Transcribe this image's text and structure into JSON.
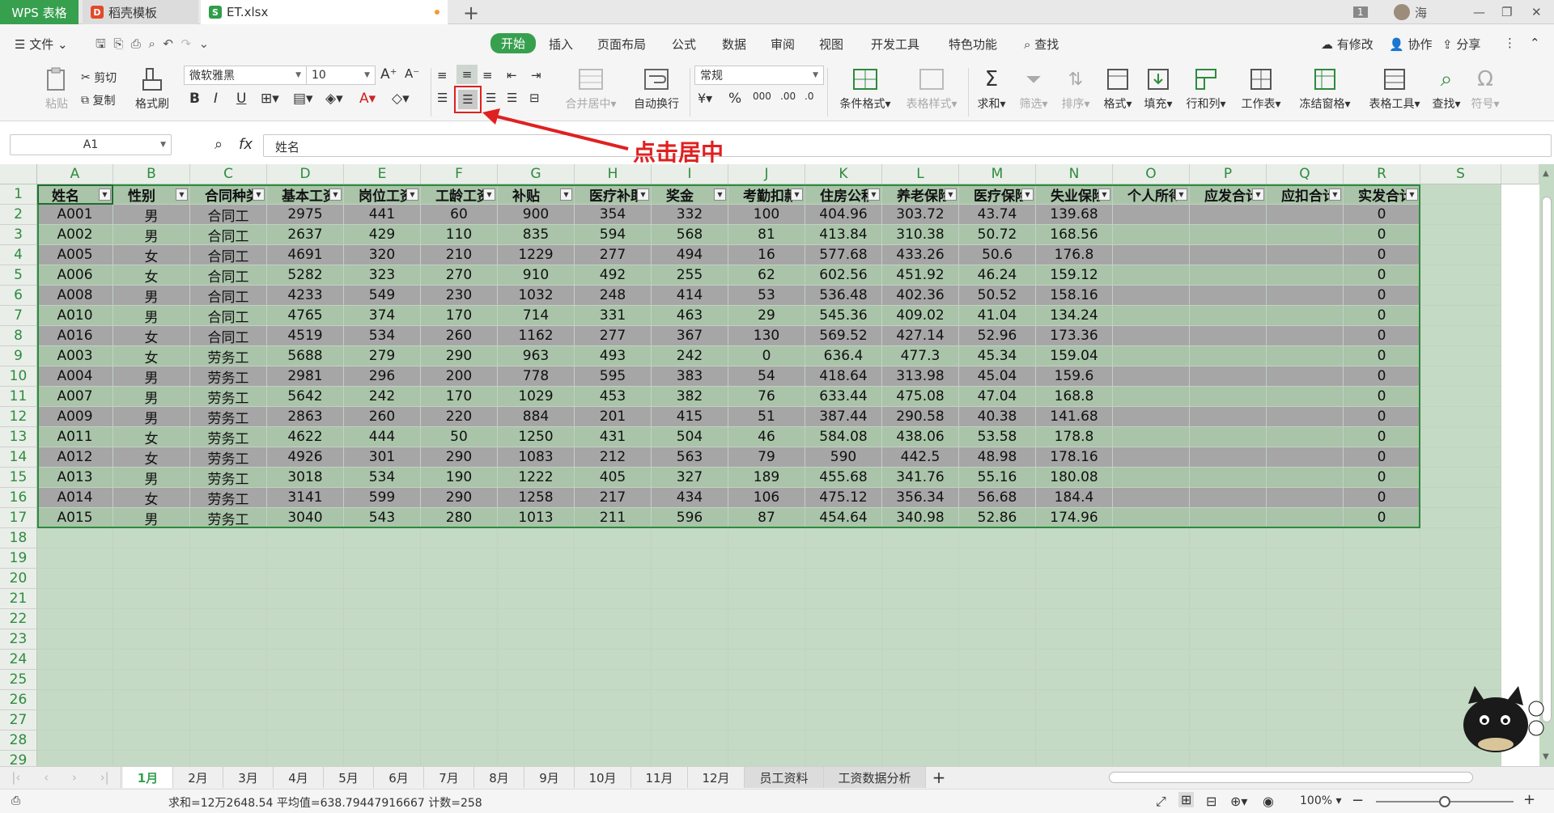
{
  "titlebar": {
    "tabs": [
      {
        "label": "WPS 表格"
      },
      {
        "label": "稻壳模板"
      },
      {
        "label": "ET.xlsx"
      }
    ],
    "badge": "1",
    "user": "海"
  },
  "menubar": {
    "file": "文件",
    "items": [
      "开始",
      "插入",
      "页面布局",
      "公式",
      "数据",
      "审阅",
      "视图",
      "开发工具",
      "特色功能"
    ],
    "search": "查找",
    "right": [
      "有修改",
      "协作",
      "分享"
    ]
  },
  "ribbon": {
    "paste": "粘贴",
    "cut": "剪切",
    "copy": "复制",
    "format_painter": "格式刷",
    "font_name": "微软雅黑",
    "font_size": "10",
    "merge": "合并居中",
    "wrap": "自动换行",
    "number_format": "常规",
    "cond_format": "条件格式",
    "table_style": "表格样式",
    "sum": "求和",
    "filter": "筛选",
    "sort": "排序",
    "format": "格式",
    "fill": "填充",
    "rowcol": "行和列",
    "sheet": "工作表",
    "freeze": "冻结窗格",
    "table_tools": "表格工具",
    "find": "查找",
    "symbol": "符号"
  },
  "formula_bar": {
    "name_box": "A1",
    "fx": "fx",
    "content": "姓名"
  },
  "annotation": "点击居中",
  "columns": [
    "A",
    "B",
    "C",
    "D",
    "E",
    "F",
    "G",
    "H",
    "I",
    "J",
    "K",
    "L",
    "M",
    "N",
    "O",
    "P",
    "Q",
    "R",
    "S"
  ],
  "headers": [
    "姓名",
    "性别",
    "合同种类",
    "基本工资",
    "岗位工资",
    "工龄工资",
    "补贴",
    "医疗补助",
    "奖金",
    "考勤扣款",
    "住房公积金",
    "养老保险",
    "医疗保险",
    "失业保险",
    "个人所得税",
    "应发合计",
    "应扣合计",
    "实发合计"
  ],
  "rows": [
    [
      "A001",
      "男",
      "合同工",
      "2975",
      "441",
      "60",
      "900",
      "354",
      "332",
      "100",
      "404.96",
      "303.72",
      "43.74",
      "139.68",
      "",
      "",
      "",
      "0"
    ],
    [
      "A002",
      "男",
      "合同工",
      "2637",
      "429",
      "110",
      "835",
      "594",
      "568",
      "81",
      "413.84",
      "310.38",
      "50.72",
      "168.56",
      "",
      "",
      "",
      "0"
    ],
    [
      "A005",
      "女",
      "合同工",
      "4691",
      "320",
      "210",
      "1229",
      "277",
      "494",
      "16",
      "577.68",
      "433.26",
      "50.6",
      "176.8",
      "",
      "",
      "",
      "0"
    ],
    [
      "A006",
      "女",
      "合同工",
      "5282",
      "323",
      "270",
      "910",
      "492",
      "255",
      "62",
      "602.56",
      "451.92",
      "46.24",
      "159.12",
      "",
      "",
      "",
      "0"
    ],
    [
      "A008",
      "男",
      "合同工",
      "4233",
      "549",
      "230",
      "1032",
      "248",
      "414",
      "53",
      "536.48",
      "402.36",
      "50.52",
      "158.16",
      "",
      "",
      "",
      "0"
    ],
    [
      "A010",
      "男",
      "合同工",
      "4765",
      "374",
      "170",
      "714",
      "331",
      "463",
      "29",
      "545.36",
      "409.02",
      "41.04",
      "134.24",
      "",
      "",
      "",
      "0"
    ],
    [
      "A016",
      "女",
      "合同工",
      "4519",
      "534",
      "260",
      "1162",
      "277",
      "367",
      "130",
      "569.52",
      "427.14",
      "52.96",
      "173.36",
      "",
      "",
      "",
      "0"
    ],
    [
      "A003",
      "女",
      "劳务工",
      "5688",
      "279",
      "290",
      "963",
      "493",
      "242",
      "0",
      "636.4",
      "477.3",
      "45.34",
      "159.04",
      "",
      "",
      "",
      "0"
    ],
    [
      "A004",
      "男",
      "劳务工",
      "2981",
      "296",
      "200",
      "778",
      "595",
      "383",
      "54",
      "418.64",
      "313.98",
      "45.04",
      "159.6",
      "",
      "",
      "",
      "0"
    ],
    [
      "A007",
      "男",
      "劳务工",
      "5642",
      "242",
      "170",
      "1029",
      "453",
      "382",
      "76",
      "633.44",
      "475.08",
      "47.04",
      "168.8",
      "",
      "",
      "",
      "0"
    ],
    [
      "A009",
      "男",
      "劳务工",
      "2863",
      "260",
      "220",
      "884",
      "201",
      "415",
      "51",
      "387.44",
      "290.58",
      "40.38",
      "141.68",
      "",
      "",
      "",
      "0"
    ],
    [
      "A011",
      "女",
      "劳务工",
      "4622",
      "444",
      "50",
      "1250",
      "431",
      "504",
      "46",
      "584.08",
      "438.06",
      "53.58",
      "178.8",
      "",
      "",
      "",
      "0"
    ],
    [
      "A012",
      "女",
      "劳务工",
      "4926",
      "301",
      "290",
      "1083",
      "212",
      "563",
      "79",
      "590",
      "442.5",
      "48.98",
      "178.16",
      "",
      "",
      "",
      "0"
    ],
    [
      "A013",
      "男",
      "劳务工",
      "3018",
      "534",
      "190",
      "1222",
      "405",
      "327",
      "189",
      "455.68",
      "341.76",
      "55.16",
      "180.08",
      "",
      "",
      "",
      "0"
    ],
    [
      "A014",
      "女",
      "劳务工",
      "3141",
      "599",
      "290",
      "1258",
      "217",
      "434",
      "106",
      "475.12",
      "356.34",
      "56.68",
      "184.4",
      "",
      "",
      "",
      "0"
    ],
    [
      "A015",
      "男",
      "劳务工",
      "3040",
      "543",
      "280",
      "1013",
      "211",
      "596",
      "87",
      "454.64",
      "340.98",
      "52.86",
      "174.96",
      "",
      "",
      "",
      "0"
    ]
  ],
  "row_numbers": [
    "1",
    "2",
    "3",
    "4",
    "5",
    "6",
    "7",
    "8",
    "9",
    "10",
    "11",
    "12",
    "13",
    "14",
    "15",
    "16",
    "17",
    "18",
    "19",
    "20",
    "21",
    "22",
    "23",
    "24",
    "25",
    "26",
    "27",
    "28",
    "29"
  ],
  "sheet_tabs": [
    "1月",
    "2月",
    "3月",
    "4月",
    "5月",
    "6月",
    "7月",
    "8月",
    "9月",
    "10月",
    "11月",
    "12月",
    "员工资料",
    "工资数据分析"
  ],
  "active_sheet": "1月",
  "status": {
    "text": "求和=12万2648.54  平均值=638.79447916667  计数=258",
    "zoom": "100%"
  },
  "colors": {
    "brand": "#37a04f",
    "row_a": "#a9c4a9",
    "row_b": "#a6a6a6",
    "empty": "#c4dac4",
    "annotation": "#e02020"
  }
}
